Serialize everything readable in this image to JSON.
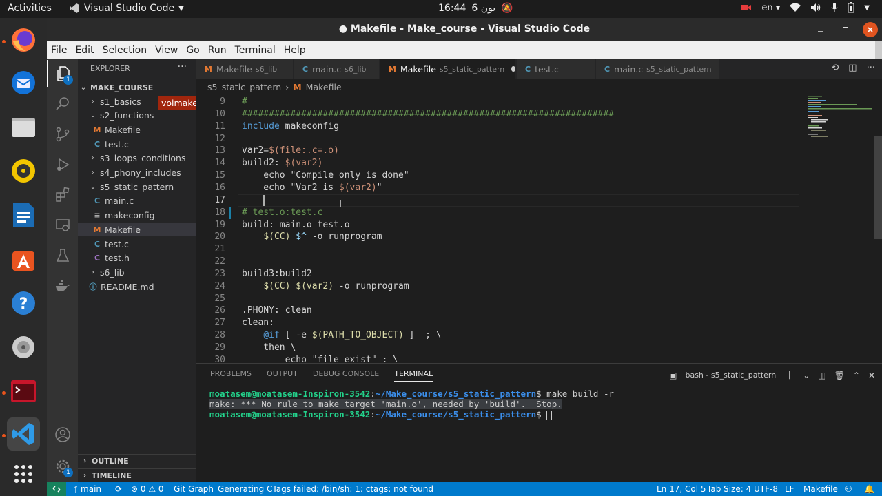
{
  "topbar": {
    "activities": "Activities",
    "app_name": "Visual Studio Code",
    "clock_time": "16:44",
    "clock_date": "يون 6",
    "lang": "en"
  },
  "window": {
    "title": "● Makefile - Make_course - Visual Studio Code"
  },
  "menu": [
    "File",
    "Edit",
    "Selection",
    "View",
    "Go",
    "Run",
    "Terminal",
    "Help"
  ],
  "dock": [
    "firefox-icon",
    "thunderbird-icon",
    "files-icon",
    "rhythmbox-icon",
    "writer-icon",
    "app-center-icon",
    "help-icon",
    "disks-icon",
    "terminal-app-icon",
    "vscode-icon",
    "show-apps-icon"
  ],
  "activity_badges": {
    "explorer": "1",
    "manage": "1"
  },
  "explorer": {
    "header": "EXPLORER",
    "more": "···",
    "root": "MAKE_COURSE",
    "tooltip": "voimake",
    "items": [
      {
        "label": "s1_basics",
        "type": "folder",
        "open": false,
        "indent": 1
      },
      {
        "label": "s2_functions",
        "type": "folder",
        "open": true,
        "indent": 1
      },
      {
        "label": "Makefile",
        "type": "makefile",
        "indent": 2
      },
      {
        "label": "test.c",
        "type": "c",
        "indent": 2
      },
      {
        "label": "s3_loops_conditions",
        "type": "folder",
        "open": false,
        "indent": 1
      },
      {
        "label": "s4_phony_includes",
        "type": "folder",
        "open": false,
        "indent": 1
      },
      {
        "label": "s5_static_pattern",
        "type": "folder",
        "open": true,
        "indent": 1
      },
      {
        "label": "main.c",
        "type": "c",
        "indent": 2
      },
      {
        "label": "makeconfig",
        "type": "config",
        "indent": 2
      },
      {
        "label": "Makefile",
        "type": "makefile",
        "indent": 2,
        "selected": true
      },
      {
        "label": "test.c",
        "type": "c",
        "indent": 2
      },
      {
        "label": "test.h",
        "type": "h",
        "indent": 2
      },
      {
        "label": "s6_lib",
        "type": "folder",
        "open": false,
        "indent": 1
      },
      {
        "label": "README.md",
        "type": "info",
        "indent": 1
      }
    ],
    "outline": "OUTLINE",
    "timeline": "TIMELINE"
  },
  "tabs": [
    {
      "label": "Makefile",
      "desc": "s6_lib",
      "type": "makefile"
    },
    {
      "label": "main.c",
      "desc": "s6_lib",
      "type": "c"
    },
    {
      "label": "Makefile",
      "desc": "s5_static_pattern",
      "type": "makefile",
      "active": true,
      "dirty": true
    },
    {
      "label": "test.c",
      "desc": "",
      "type": "c"
    },
    {
      "label": "main.c",
      "desc": "s5_static_pattern",
      "type": "c"
    }
  ],
  "breadcrumb": {
    "folder": "s5_static_pattern",
    "file": "Makefile"
  },
  "editor": {
    "current_line": 17,
    "lines": [
      {
        "n": 9,
        "tokens": [
          {
            "t": "#",
            "c": "c-com"
          }
        ]
      },
      {
        "n": 10,
        "tokens": [
          {
            "t": "#####################################################################",
            "c": "c-com"
          }
        ]
      },
      {
        "n": 11,
        "tokens": [
          {
            "t": "include",
            "c": "c-kw"
          },
          {
            "t": " makeconfig",
            "c": "c-pun"
          }
        ]
      },
      {
        "n": 12,
        "tokens": []
      },
      {
        "n": 13,
        "tokens": [
          {
            "t": "var2=",
            "c": "c-pun"
          },
          {
            "t": "$(",
            "c": "c-str"
          },
          {
            "t": "file",
            "c": "c-str"
          },
          {
            "t": ":.c=.o",
            "c": "c-str"
          },
          {
            "t": ")",
            "c": "c-str"
          }
        ]
      },
      {
        "n": 14,
        "tokens": [
          {
            "t": "build2: ",
            "c": "c-pun"
          },
          {
            "t": "$(var2)",
            "c": "c-str"
          }
        ]
      },
      {
        "n": 15,
        "tokens": [
          {
            "t": "    echo ",
            "c": "c-pun"
          },
          {
            "t": "\"Compile only is done\"",
            "c": "c-pun"
          }
        ]
      },
      {
        "n": 16,
        "tokens": [
          {
            "t": "    echo ",
            "c": "c-pun"
          },
          {
            "t": "\"Var2 is ",
            "c": "c-pun"
          },
          {
            "t": "$(var2)",
            "c": "c-str"
          },
          {
            "t": "\"",
            "c": "c-pun"
          }
        ]
      },
      {
        "n": 17,
        "tokens": []
      },
      {
        "n": 18,
        "tokens": [
          {
            "t": "# test.o:test.c",
            "c": "c-com"
          }
        ]
      },
      {
        "n": 19,
        "tokens": [
          {
            "t": "build: main.o test.o",
            "c": "c-pun"
          }
        ]
      },
      {
        "n": 20,
        "tokens": [
          {
            "t": "    ",
            "c": "c-pun"
          },
          {
            "t": "$(CC)",
            "c": "c-fn"
          },
          {
            "t": " ",
            "c": "c-pun"
          },
          {
            "t": "$^",
            "c": "c-var"
          },
          {
            "t": " -o runprogram",
            "c": "c-pun"
          }
        ]
      },
      {
        "n": 21,
        "tokens": []
      },
      {
        "n": 22,
        "tokens": []
      },
      {
        "n": 23,
        "tokens": [
          {
            "t": "build3:build2",
            "c": "c-pun"
          }
        ]
      },
      {
        "n": 24,
        "tokens": [
          {
            "t": "    ",
            "c": "c-pun"
          },
          {
            "t": "$(CC)",
            "c": "c-fn"
          },
          {
            "t": " ",
            "c": "c-pun"
          },
          {
            "t": "$(var2)",
            "c": "c-fn"
          },
          {
            "t": " -o runprogram",
            "c": "c-pun"
          }
        ]
      },
      {
        "n": 25,
        "tokens": []
      },
      {
        "n": 26,
        "tokens": [
          {
            "t": ".PHONY: clean",
            "c": "c-pun"
          }
        ]
      },
      {
        "n": 27,
        "tokens": [
          {
            "t": "clean:",
            "c": "c-pun"
          }
        ]
      },
      {
        "n": 28,
        "tokens": [
          {
            "t": "    ",
            "c": "c-pun"
          },
          {
            "t": "@if",
            "c": "c-kw"
          },
          {
            "t": " [ -e ",
            "c": "c-pun"
          },
          {
            "t": "$(PATH_TO_OBJECT)",
            "c": "c-fn"
          },
          {
            "t": " ]  ; \\",
            "c": "c-pun"
          }
        ]
      },
      {
        "n": 29,
        "tokens": [
          {
            "t": "    then \\",
            "c": "c-pun"
          }
        ]
      },
      {
        "n": 30,
        "tokens": [
          {
            "t": "        echo \"file exist\" ; \\",
            "c": "c-pun"
          }
        ]
      }
    ]
  },
  "panel": {
    "tabs": [
      "PROBLEMS",
      "OUTPUT",
      "DEBUG CONSOLE",
      "TERMINAL"
    ],
    "active_tab": "TERMINAL",
    "terminal_name": "bash - s5_static_pattern",
    "terminal": {
      "line1_user": "moatasem@moatasem-Inspiron-3542",
      "line1_sep": ":",
      "line1_path": "~/Make_course/s5_static_pattern",
      "line1_cmd": "$ make build -r",
      "line2": "make: *** No rule to make target 'main.o', needed by 'build'.  Stop.",
      "line3_user": "moatasem@moatasem-Inspiron-3542",
      "line3_sep": ":",
      "line3_path": "~/Make_course/s5_static_pattern",
      "line3_cmd": "$ "
    }
  },
  "status": {
    "branch": "main",
    "problems": "⊗ 0 ⚠ 0",
    "git_graph": "Git Graph",
    "message": "Generating CTags failed: /bin/sh: 1: ctags: not found",
    "position": "Ln 17, Col 5",
    "tab_size": "Tab Size: 4",
    "encoding": "UTF-8",
    "eol": "LF",
    "language": "Makefile"
  }
}
